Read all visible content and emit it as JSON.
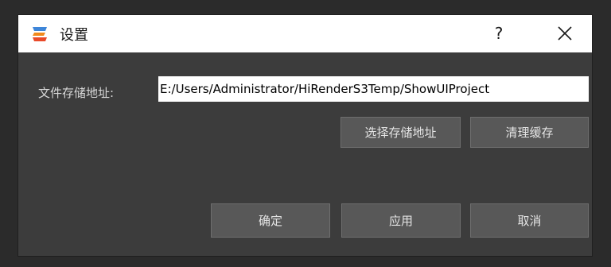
{
  "window": {
    "title": "设置",
    "help_label": "?"
  },
  "storage": {
    "label": "文件存储地址:",
    "path_value": "E:/Users/Administrator/HiRenderS3Temp/ShowUIProject",
    "select_button": "选择存储地址",
    "clear_button": "清理缓存"
  },
  "actions": {
    "ok": "确定",
    "apply": "应用",
    "cancel": "取消"
  },
  "icons": {
    "app": "app-logo-icon",
    "close": "close-icon"
  },
  "colors": {
    "dialog_bg": "#3c3c3c",
    "button_bg": "#585858",
    "titlebar_bg": "#ffffff",
    "logo_top": "#3e86d9",
    "logo_bottom": "#e94a2a"
  }
}
